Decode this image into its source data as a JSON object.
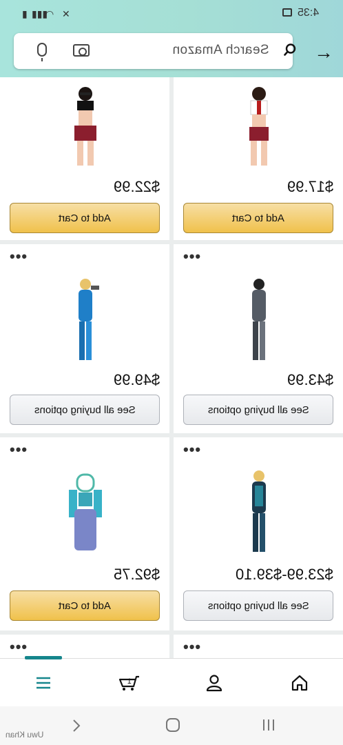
{
  "status_bar": {
    "time": "4:35"
  },
  "search": {
    "placeholder": "Search Amazon"
  },
  "products": [
    {
      "price": "$17.99",
      "button": "Add to Cart",
      "button_type": "cart"
    },
    {
      "price": "$22.99",
      "button": "Add to Cart",
      "button_type": "cart"
    },
    {
      "price": "$43.99",
      "button": "See all buying options",
      "button_type": "options"
    },
    {
      "price": "$49.99",
      "button": "See all buying options",
      "button_type": "options"
    },
    {
      "price": "$23.99-$39.10",
      "button": "See all buying options",
      "button_type": "options"
    },
    {
      "price": "$92.75",
      "button": "Add to Cart",
      "button_type": "cart"
    }
  ],
  "bottom_nav": {
    "items": [
      {
        "icon": "home-icon"
      },
      {
        "icon": "account-icon"
      },
      {
        "icon": "cart-icon",
        "count": "1"
      },
      {
        "icon": "menu-icon"
      }
    ],
    "active": "menu-icon"
  },
  "watermark": "Uwu Khan",
  "colors": {
    "header_gradient": "#a8e4dc",
    "accent": "#16868c",
    "cart_button": "#f0c14b",
    "background": "#eaeded"
  }
}
